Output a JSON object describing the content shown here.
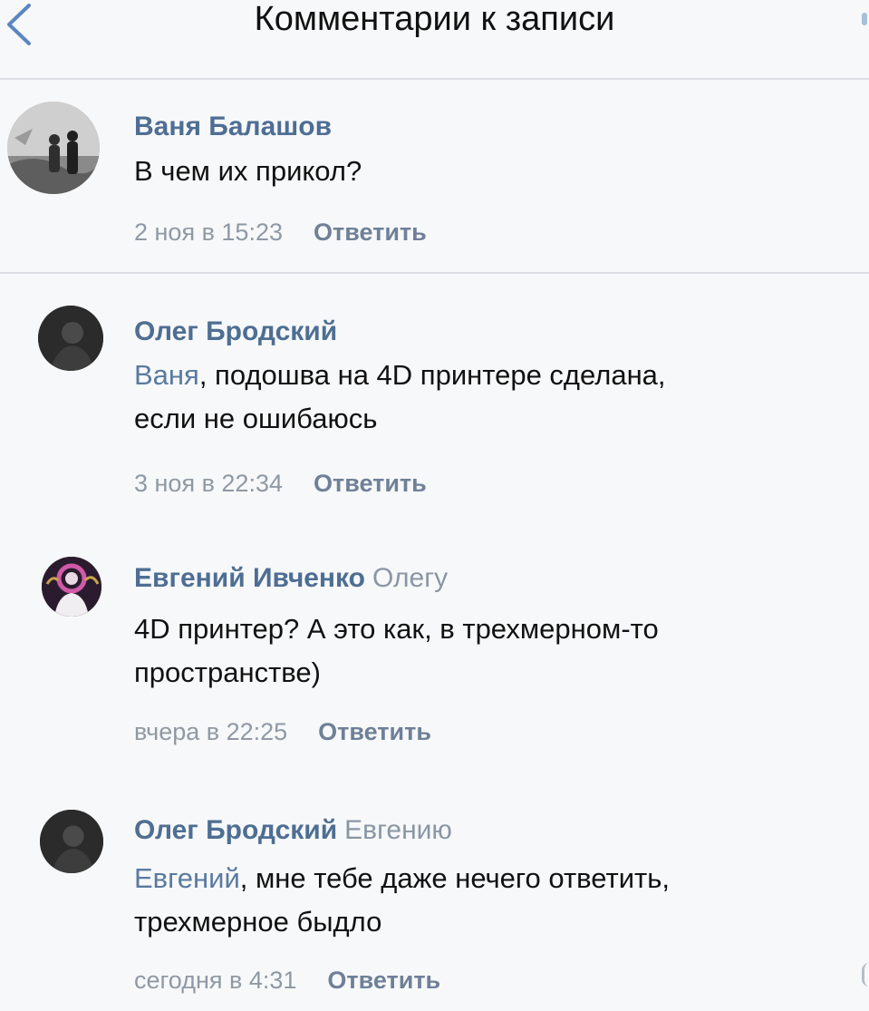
{
  "header": {
    "title": "Комментарии к записи"
  },
  "colors": {
    "author": "#4e6e93",
    "mention": "#5a7aa0",
    "meta": "#8f99a4",
    "reply": "#6f8098",
    "background": "#f7f8f9"
  },
  "comments": [
    {
      "author": "Ваня Балашов",
      "reply_to": "",
      "mention": "",
      "line1": "В чем их прикол?",
      "line2": "",
      "time": "2 ноя в 15:23",
      "reply_label": "Ответить",
      "avatar": "photo-two-people-avatar"
    },
    {
      "author": "Олег Бродский",
      "reply_to": "",
      "mention": "Ваня",
      "line1": ", подошва на 4D принтере сделана,",
      "line2": "если не ошибаюсь",
      "time": "3 ноя в 22:34",
      "reply_label": "Ответить",
      "avatar": "dark-photo-avatar"
    },
    {
      "author": "Евгений Ивченко",
      "reply_to": "Олегу",
      "mention": "",
      "line1": "4D принтер? А это как, в трехмерном-то",
      "line2": "пространстве)",
      "time": "вчера в 22:25",
      "reply_label": "Ответить",
      "avatar": "neon-photo-avatar"
    },
    {
      "author": "Олег Бродский",
      "reply_to": "Евгению",
      "mention": "Евгений",
      "line1": ", мне тебе даже нечего ответить,",
      "line2": "трехмерное быдло",
      "time": "сегодня в 4:31",
      "reply_label": "Ответить",
      "avatar": "dark-photo-avatar"
    }
  ]
}
